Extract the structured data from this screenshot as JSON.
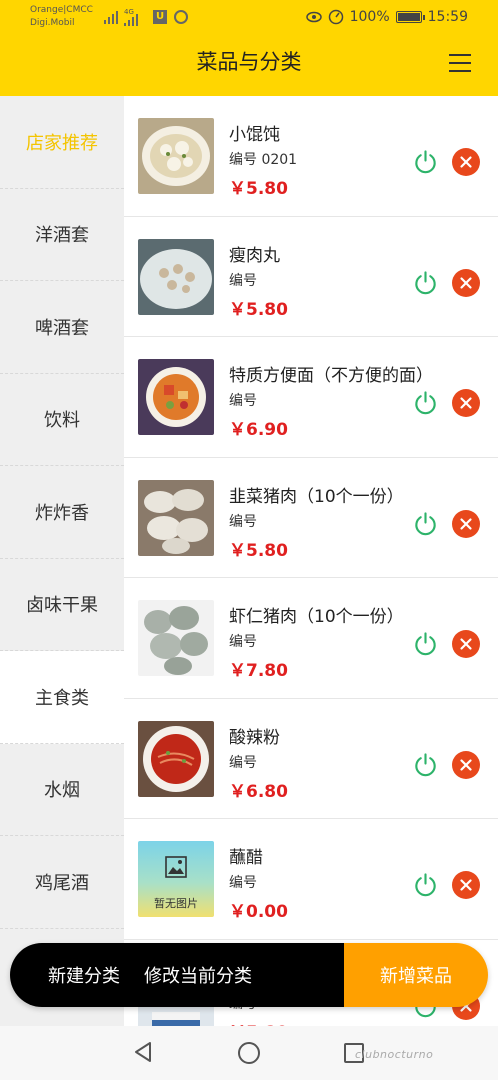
{
  "status_bar": {
    "carrier_line1": "Orange|CMCC",
    "carrier_line2": "Digi.Mobil",
    "network": "4G",
    "battery": "100%",
    "time": "15:59"
  },
  "header": {
    "title": "菜品与分类"
  },
  "categories": [
    {
      "label": "店家推荐"
    },
    {
      "label": "洋酒套"
    },
    {
      "label": "啤酒套"
    },
    {
      "label": "饮料"
    },
    {
      "label": "炸炸香"
    },
    {
      "label": "卤味干果"
    },
    {
      "label": "主食类"
    },
    {
      "label": "水烟"
    },
    {
      "label": "鸡尾酒"
    }
  ],
  "dishes": [
    {
      "name": "小馄饨",
      "code": "编号 0201",
      "price": "￥5.80"
    },
    {
      "name": "瘦肉丸",
      "code": "编号",
      "price": "￥5.80"
    },
    {
      "name": "特质方便面（不方便的面）",
      "code": "编号",
      "price": "￥6.90"
    },
    {
      "name": "韭菜猪肉（10个一份）",
      "code": "编号",
      "price": "￥5.80"
    },
    {
      "name": "虾仁猪肉（10个一份）",
      "code": "编号",
      "price": "￥7.80"
    },
    {
      "name": "酸辣粉",
      "code": "编号",
      "price": "￥6.80"
    },
    {
      "name": "蘸醋",
      "code": "编号",
      "price": "￥0.00",
      "placeholder_text": "暂无图片"
    },
    {
      "name": "",
      "code": "编号",
      "price": "￥5.80"
    }
  ],
  "bottom_bar": {
    "new_category": "新建分类",
    "edit_category": "修改当前分类",
    "add_dish": "新增菜品"
  },
  "watermark": "clubnocturno",
  "colors": {
    "brand_yellow": "#FFD600",
    "price_red": "#E02020",
    "power_green": "#2DB36A",
    "delete_red": "#E8481C",
    "add_orange": "#FFA000"
  }
}
